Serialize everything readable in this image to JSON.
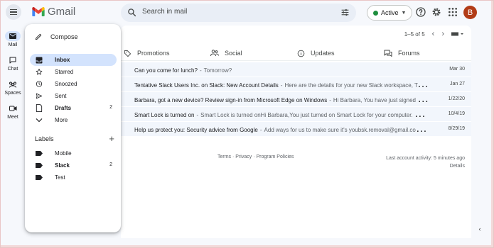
{
  "app": {
    "name": "Gmail"
  },
  "search": {
    "placeholder": "Search in mail"
  },
  "status": {
    "label": "Active",
    "color": "#1e8e3e"
  },
  "account": {
    "initial": "B",
    "color": "#b23c17"
  },
  "top_icons": [
    "support-icon",
    "settings-icon",
    "apps-icon"
  ],
  "rail": [
    {
      "label": "Mail",
      "icon": "mail-icon",
      "active": true
    },
    {
      "label": "Chat",
      "icon": "chat-icon"
    },
    {
      "label": "Spaces",
      "icon": "spaces-icon"
    },
    {
      "label": "Meet",
      "icon": "meet-icon"
    }
  ],
  "drawer": {
    "compose_label": "Compose",
    "items": [
      {
        "label": "Inbox",
        "icon": "inbox-icon",
        "active": true,
        "bold": true,
        "count": ""
      },
      {
        "label": "Starred",
        "icon": "star-icon",
        "count": ""
      },
      {
        "label": "Snoozed",
        "icon": "snooze-icon",
        "count": ""
      },
      {
        "label": "Sent",
        "icon": "send-icon",
        "count": ""
      },
      {
        "label": "Drafts",
        "icon": "draft-icon",
        "bold": true,
        "count": "2"
      },
      {
        "label": "More",
        "icon": "chevron-down-icon",
        "count": ""
      }
    ],
    "labels_title": "Labels",
    "labels": [
      {
        "name": "Mobile",
        "count": ""
      },
      {
        "name": "Slack",
        "bold": true,
        "count": "2"
      },
      {
        "name": "Test",
        "count": ""
      }
    ]
  },
  "toolbar": {
    "pager_text": "1–5 of 5"
  },
  "tabs": [
    {
      "label": "Promotions",
      "icon": "tag-icon"
    },
    {
      "label": "Social",
      "icon": "people-icon"
    },
    {
      "label": "Updates",
      "icon": "info-icon"
    },
    {
      "label": "Forums",
      "icon": "forum-icon"
    }
  ],
  "emails": [
    {
      "subject": "Can you come for lunch?",
      "snippet": "Tomorrow?",
      "date": "Mar 30"
    },
    {
      "subject": "Tentative Slack Users Inc. on Slack: New Account Details",
      "snippet": "Here are the details for your new Slack workspace, Tentative Slack Users Inc.",
      "date": "Jan 27"
    },
    {
      "subject": "Barbara, got a new device? Review sign-in from Microsoft Edge on Windows",
      "snippet": "Hi Barbara, You have just signed in on a new device",
      "date": "1/22/20"
    },
    {
      "subject": "Smart Lock is turned on",
      "snippet": "Smart Lock is turned onHi Barbara,You just turned on Smart Lock for your computer. Now your phone",
      "date": "10/4/19"
    },
    {
      "subject": "Help us protect you: Security advice from Google",
      "snippet": "Add ways for us to make sure it's youbsk.removal@gmail.comUsers with",
      "date": "8/29/19"
    }
  ],
  "footer": {
    "terms": "Terms",
    "sep": " · ",
    "privacy": "Privacy",
    "policies": "Program Policies",
    "activity": "Last account activity: 5 minutes ago",
    "details": "Details"
  },
  "colors": {
    "accent": "#d3e3fd",
    "row_bg": "#f2f6fc",
    "page_bg": "#f6f8fc"
  }
}
